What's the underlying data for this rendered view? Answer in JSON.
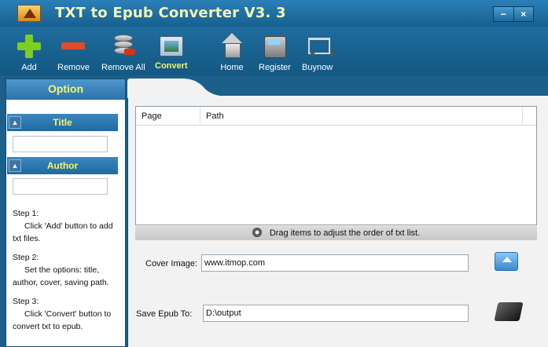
{
  "window": {
    "title": "TXT to Epub Converter V3. 3",
    "minimize_label": "−",
    "close_label": "×"
  },
  "toolbar": {
    "items": [
      {
        "label": "Add",
        "icon": "add-icon"
      },
      {
        "label": "Remove",
        "icon": "remove-icon"
      },
      {
        "label": "Remove All",
        "icon": "remove-all-icon"
      },
      {
        "label": "Convert",
        "icon": "convert-icon",
        "active": true
      },
      {
        "label": "Home",
        "icon": "home-icon"
      },
      {
        "label": "Register",
        "icon": "register-icon"
      },
      {
        "label": "Buynow",
        "icon": "cart-icon"
      }
    ]
  },
  "sidebar": {
    "header": "Option",
    "title_section": {
      "label": "Title",
      "value": ""
    },
    "author_section": {
      "label": "Author",
      "value": ""
    },
    "steps": [
      {
        "label": "Step 1:",
        "text": "Click 'Add' button to add txt files."
      },
      {
        "label": "Step 2:",
        "text": "Set the options: title, author, cover, saving path."
      },
      {
        "label": "Step 3:",
        "text": "Click 'Convert' button to convert txt to epub."
      }
    ]
  },
  "list": {
    "columns": [
      "Page",
      "Path"
    ],
    "rows": [],
    "drag_hint": "Drag items to  adjust the order of txt list."
  },
  "cover": {
    "label": "Cover Image:",
    "value": "www.itmop.com"
  },
  "save": {
    "label": "Save  Epub  To:",
    "value": "D:\\output"
  },
  "colors": {
    "accent_text": "#f2f56a",
    "titlebar": "#1f6c9e"
  }
}
